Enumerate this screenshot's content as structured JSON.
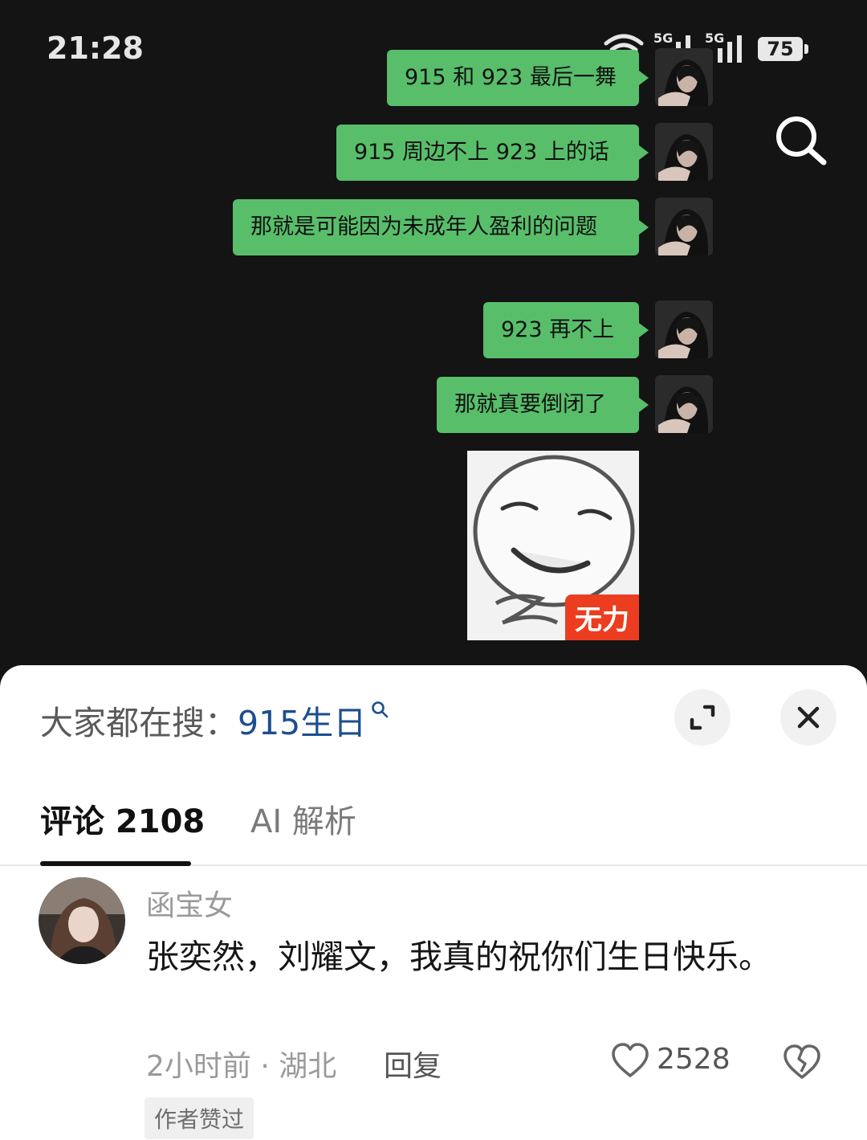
{
  "status_bar": {
    "time": "21:28",
    "network_1": "5G",
    "network_2": "5G",
    "battery": "75"
  },
  "chat": {
    "messages": [
      {
        "text": "915 和 923 最后一舞"
      },
      {
        "text": "915 周边不上 923 上的话"
      },
      {
        "text": "那就是可能因为未成年人盈利的问题"
      },
      {
        "text": "923 再不上"
      },
      {
        "text": "那就真要倒闭了"
      }
    ],
    "sticker": {
      "label": "无力"
    },
    "bubble_color": "#58be6a"
  },
  "sheet": {
    "hot_search_prefix": "大家都在搜：",
    "hot_search_keyword": "915生日",
    "tabs": [
      {
        "label": "评论 2108",
        "active": true
      },
      {
        "label": "AI 解析",
        "active": false
      }
    ]
  },
  "comment": {
    "username": "函宝女",
    "text": "张奕然，刘耀文，我真的祝你们生日快乐。",
    "meta": "2小时前 · 湖北",
    "reply_label": "回复",
    "likes": "2528",
    "badge": "作者赞过"
  }
}
